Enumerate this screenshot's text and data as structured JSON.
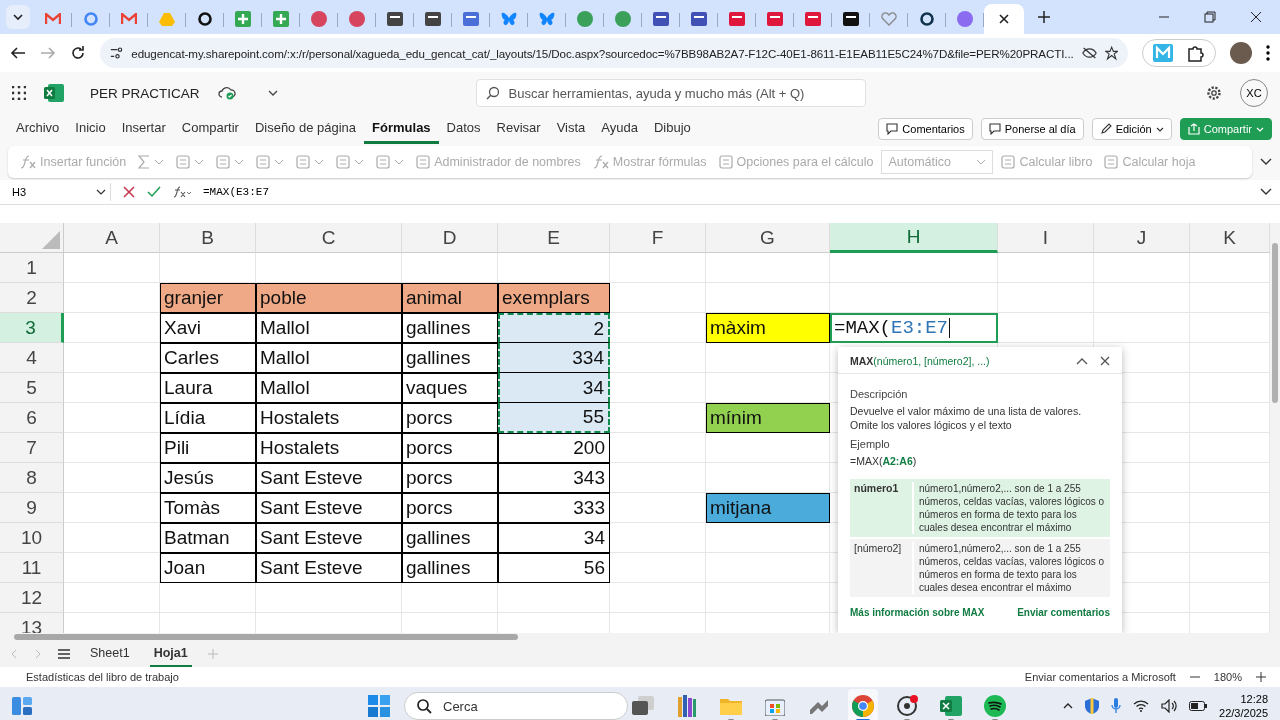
{
  "browser": {
    "tabs": [
      {
        "kind": "mail",
        "color": "#ea4335",
        "selected": false
      },
      {
        "kind": "ring",
        "color": "#4285f4",
        "selected": false
      },
      {
        "kind": "mail",
        "color": "#ea4335",
        "selected": false
      },
      {
        "kind": "triangle",
        "color": "#fbbc04",
        "selected": false
      },
      {
        "kind": "ring",
        "color": "#111111",
        "selected": false
      },
      {
        "kind": "plus",
        "color": "#34a853",
        "selected": false
      },
      {
        "kind": "plus",
        "color": "#34a853",
        "selected": false
      },
      {
        "kind": "circle",
        "color": "#d6455d",
        "selected": false
      },
      {
        "kind": "circle",
        "color": "#d6455d",
        "selected": false
      },
      {
        "kind": "square",
        "color": "#444444",
        "selected": false
      },
      {
        "kind": "square",
        "color": "#444444",
        "selected": false
      },
      {
        "kind": "square",
        "color": "#4a6fd8",
        "selected": false
      },
      {
        "kind": "butterfly",
        "color": "#1185fe",
        "selected": false
      },
      {
        "kind": "butterfly",
        "color": "#1185fe",
        "selected": false
      },
      {
        "kind": "circle",
        "color": "#3aa05a",
        "selected": false
      },
      {
        "kind": "circle",
        "color": "#3aa05a",
        "selected": false
      },
      {
        "kind": "square",
        "color": "#3f51b5",
        "selected": false
      },
      {
        "kind": "square",
        "color": "#3f51b5",
        "selected": false
      },
      {
        "kind": "square",
        "color": "#e0173c",
        "selected": false
      },
      {
        "kind": "square",
        "color": "#e0173c",
        "selected": false
      },
      {
        "kind": "square",
        "color": "#e0173c",
        "selected": false
      },
      {
        "kind": "square",
        "color": "#111111",
        "selected": false
      },
      {
        "kind": "heart",
        "color": "#888888",
        "selected": false
      },
      {
        "kind": "ring",
        "color": "#12334e",
        "selected": false
      },
      {
        "kind": "circle",
        "color": "#8b6cf0",
        "selected": false
      },
      {
        "kind": "none",
        "selected": true
      }
    ],
    "url": "edugencat-my.sharepoint.com/:x:/r/personal/xagueda_edu_gencat_cat/_layouts/15/Doc.aspx?sourcedoc=%7BB98AB2A7-F12C-40E1-8611-E1EAB11E5C24%7D&file=PER%20PRACTI..."
  },
  "app": {
    "file_name": "PER PRACTICAR",
    "search_placeholder": "Buscar herramientas, ayuda y mucho más (Alt + Q)",
    "user_initials": "XC",
    "menu": [
      {
        "label": "Archivo",
        "selected": false
      },
      {
        "label": "Inicio",
        "selected": false
      },
      {
        "label": "Insertar",
        "selected": false
      },
      {
        "label": "Compartir",
        "selected": false
      },
      {
        "label": "Diseño de página",
        "selected": false
      },
      {
        "label": "Fórmulas",
        "selected": true
      },
      {
        "label": "Datos",
        "selected": false
      },
      {
        "label": "Revisar",
        "selected": false
      },
      {
        "label": "Vista",
        "selected": false
      },
      {
        "label": "Ayuda",
        "selected": false
      },
      {
        "label": "Dibujo",
        "selected": false
      }
    ],
    "actions": [
      {
        "label": "Comentarios",
        "kind": "plain"
      },
      {
        "label": "Ponerse al día",
        "kind": "plain"
      },
      {
        "label": "Edición",
        "kind": "dropdown"
      },
      {
        "label": "Compartir",
        "kind": "primary"
      }
    ]
  },
  "ribbon": [
    {
      "kind": "fx",
      "label": "Insertar función",
      "dropdown": false,
      "disabled": true
    },
    {
      "kind": "sigma",
      "dropdown": true,
      "disabled": true
    },
    {
      "kind": "tool",
      "dropdown": true,
      "disabled": true
    },
    {
      "kind": "tool",
      "dropdown": true,
      "disabled": true
    },
    {
      "kind": "tool",
      "dropdown": true,
      "disabled": true
    },
    {
      "kind": "tool",
      "dropdown": true,
      "disabled": true
    },
    {
      "kind": "tool",
      "dropdown": true,
      "disabled": true
    },
    {
      "kind": "tool",
      "dropdown": true,
      "disabled": true
    },
    {
      "kind": "tool",
      "label": "Administrador de nombres",
      "dropdown": false,
      "disabled": true
    },
    {
      "kind": "fx",
      "label": "Mostrar fórmulas",
      "dropdown": false,
      "disabled": true
    },
    {
      "kind": "tool",
      "label": "Opciones para el cálculo",
      "dropdown": false,
      "disabled": true
    },
    {
      "kind": "select",
      "label": "Automático",
      "dropdown": true,
      "disabled": true
    },
    {
      "kind": "tool",
      "label": "Calcular libro",
      "dropdown": false,
      "disabled": true
    },
    {
      "kind": "tool",
      "label": "Calcular hoja",
      "dropdown": false,
      "disabled": true
    }
  ],
  "formula_bar": {
    "name_box": "H3",
    "formula": "=MAX(E3:E7"
  },
  "sheet": {
    "columns": [
      {
        "label": "A",
        "selected": false
      },
      {
        "label": "B",
        "selected": false
      },
      {
        "label": "C",
        "selected": false
      },
      {
        "label": "D",
        "selected": false
      },
      {
        "label": "E",
        "selected": false
      },
      {
        "label": "F",
        "selected": false
      },
      {
        "label": "G",
        "selected": false
      },
      {
        "label": "H",
        "selected": true
      },
      {
        "label": "I",
        "selected": false
      },
      {
        "label": "J",
        "selected": false
      },
      {
        "label": "K",
        "selected": false
      }
    ],
    "rows": [
      {
        "number": "1",
        "selected": false,
        "cells": []
      },
      {
        "number": "2",
        "selected": false,
        "cells": [
          null,
          {
            "text": "granjer",
            "kind": "header"
          },
          {
            "text": "poble",
            "kind": "header"
          },
          {
            "text": "animal",
            "kind": "header"
          },
          {
            "text": "exemplars",
            "kind": "header"
          }
        ]
      },
      {
        "number": "3",
        "selected": true,
        "cells": [
          null,
          {
            "text": "Xavi",
            "kind": "text"
          },
          {
            "text": "Mallol",
            "kind": "text"
          },
          {
            "text": "gallines",
            "kind": "text"
          },
          {
            "text": "2",
            "kind": "number",
            "in_range": true
          },
          null,
          {
            "text": "màxim",
            "kind": "label",
            "color": "#ffff00"
          },
          {
            "text": "=MAX(",
            "ref": "E3:E7",
            "kind": "formula"
          }
        ]
      },
      {
        "number": "4",
        "selected": false,
        "cells": [
          null,
          {
            "text": "Carles",
            "kind": "text"
          },
          {
            "text": "Mallol",
            "kind": "text"
          },
          {
            "text": "gallines",
            "kind": "text"
          },
          {
            "text": "334",
            "kind": "number",
            "in_range": true
          }
        ]
      },
      {
        "number": "5",
        "selected": false,
        "cells": [
          null,
          {
            "text": "Laura",
            "kind": "text"
          },
          {
            "text": "Mallol",
            "kind": "text"
          },
          {
            "text": "vaques",
            "kind": "text"
          },
          {
            "text": "34",
            "kind": "number",
            "in_range": true
          }
        ]
      },
      {
        "number": "6",
        "selected": false,
        "cells": [
          null,
          {
            "text": "Lídia",
            "kind": "text"
          },
          {
            "text": "Hostalets",
            "kind": "text"
          },
          {
            "text": "porcs",
            "kind": "text"
          },
          {
            "text": "55",
            "kind": "number",
            "in_range": true
          },
          null,
          {
            "text": "mínim",
            "kind": "label",
            "color": "#92d050"
          }
        ]
      },
      {
        "number": "7",
        "selected": false,
        "cells": [
          null,
          {
            "text": "Pili",
            "kind": "text"
          },
          {
            "text": "Hostalets",
            "kind": "text"
          },
          {
            "text": "porcs",
            "kind": "text"
          },
          {
            "text": "200",
            "kind": "number",
            "in_range": false
          }
        ]
      },
      {
        "number": "8",
        "selected": false,
        "cells": [
          null,
          {
            "text": "Jesús",
            "kind": "text"
          },
          {
            "text": "Sant Esteve",
            "kind": "text"
          },
          {
            "text": "porcs",
            "kind": "text"
          },
          {
            "text": "343",
            "kind": "number",
            "in_range": false
          }
        ]
      },
      {
        "number": "9",
        "selected": false,
        "cells": [
          null,
          {
            "text": "Tomàs",
            "kind": "text"
          },
          {
            "text": "Sant Esteve",
            "kind": "text"
          },
          {
            "text": "porcs",
            "kind": "text"
          },
          {
            "text": "333",
            "kind": "number",
            "in_range": false
          },
          null,
          {
            "text": "mitjana",
            "kind": "label",
            "color": "#4bacdc"
          }
        ]
      },
      {
        "number": "10",
        "selected": false,
        "cells": [
          null,
          {
            "text": "Batman",
            "kind": "text"
          },
          {
            "text": "Sant Esteve",
            "kind": "text"
          },
          {
            "text": "gallines",
            "kind": "text"
          },
          {
            "text": "34",
            "kind": "number",
            "in_range": false
          }
        ]
      },
      {
        "number": "11",
        "selected": false,
        "cells": [
          null,
          {
            "text": "Joan",
            "kind": "text"
          },
          {
            "text": "Sant Esteve",
            "kind": "text"
          },
          {
            "text": "gallines",
            "kind": "text"
          },
          {
            "text": "56",
            "kind": "number",
            "in_range": false
          }
        ]
      },
      {
        "number": "12",
        "selected": false,
        "cells": []
      },
      {
        "number": "13",
        "selected": false,
        "cells": []
      }
    ]
  },
  "function_tooltip": {
    "name": "MAX",
    "signature_args": "(número1, [número2], ...)",
    "description_heading": "Descripción",
    "description": "Devuelve el valor máximo de una lista de valores. Omite los valores lógicos y el texto",
    "example_heading": "Ejemplo",
    "example_prefix": "=MAX(",
    "example_args": "A2:A6",
    "example_suffix": ")",
    "arguments": [
      {
        "name": "número1",
        "description": "número1,número2,... son de 1 a 255 números, celdas vacías, valores lógicos o números en forma de texto para los cuales desea encontrar el máximo",
        "selected": true
      },
      {
        "name": "[número2]",
        "description": "número1,número2,... son de 1 a 255 números, celdas vacías, valores lógicos o números en forma de texto para los cuales desea encontrar el máximo",
        "selected": false
      }
    ],
    "more_link": "Más información sobre MAX",
    "feedback_link": "Enviar comentarios"
  },
  "sheet_tabs": [
    {
      "label": "Sheet1",
      "selected": false
    },
    {
      "label": "Hoja1",
      "selected": true
    }
  ],
  "status_bar": {
    "left": "Estadísticas del libro de trabajo",
    "feedback": "Enviar comentarios a Microsoft",
    "zoom": "180%"
  },
  "taskbar": {
    "search_placeholder": "Cerca",
    "apps": [
      {
        "kind": "taskview",
        "running": false,
        "selected": false
      },
      {
        "kind": "books",
        "running": false,
        "selected": false
      },
      {
        "kind": "folder",
        "running": true,
        "selected": false
      },
      {
        "kind": "store",
        "running": true,
        "selected": false
      },
      {
        "kind": "tool",
        "running": false,
        "selected": false
      },
      {
        "kind": "chrome",
        "running": true,
        "selected": true
      },
      {
        "kind": "obs",
        "running": true,
        "selected": false
      },
      {
        "kind": "excel",
        "running": true,
        "selected": false
      },
      {
        "kind": "spotify",
        "running": true,
        "selected": false
      }
    ],
    "time": "12:28",
    "date": "22/3/2025"
  }
}
